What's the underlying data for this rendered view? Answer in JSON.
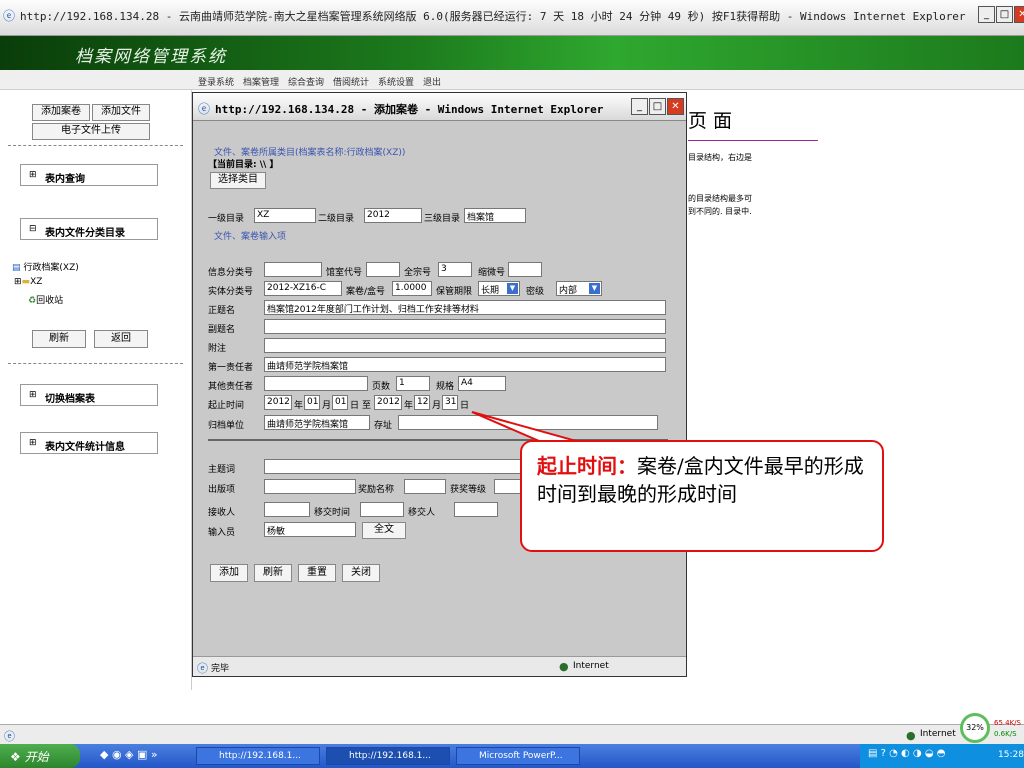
{
  "outer_window": {
    "title": "http://192.168.134.28 - 云南曲靖师范学院-南大之星档案管理系统网络版 6.0(服务器已经运行: 7 天 18 小时 24 分钟 49 秒) 按F1获得帮助 - Windows Internet Explorer"
  },
  "app": {
    "banner_title": "档案网络管理系统",
    "menu": [
      "登录系统",
      "档案管理",
      "综合查询",
      "借阅统计",
      "系统设置",
      "退出"
    ]
  },
  "sidebar": {
    "add_volume": "添加案卷",
    "add_file": "添加文件",
    "e_file_upload": "电子文件上传",
    "table_query": "表内查询",
    "table_dir": "表内文件分类目录",
    "tree_root": "行政档案(XZ)",
    "tree_child": "XZ",
    "tree_recycle": "回收站",
    "refresh": "刷新",
    "back": "返回",
    "switch_table": "切换档案表",
    "stats": "表内文件统计信息"
  },
  "background_page": {
    "heading": "页 面",
    "line1": "目录结构，右边是",
    "line2": "的目录结构最多可",
    "line3": "到不同的. 目录中."
  },
  "popup": {
    "title": "http://192.168.134.28 - 添加案卷 - Windows Internet Explorer",
    "category_line": "文件、案卷所属类目(档案表名称:行政档案(XZ))",
    "current_dir": "【当前目录: \\\\ 】",
    "select_category": "选择类目",
    "level1_label": "一级目录",
    "level1_value": "XZ",
    "level2_label": "二级目录",
    "level2_value": "2012",
    "level3_label": "三级目录",
    "level3_value": "档案馆",
    "input_section": "文件、案卷输入项",
    "info_class_label": "信息分类号",
    "archive_code_label": "馆室代号",
    "fonds_label": "全宗号",
    "fonds_value": "3",
    "microfilm_label": "缩微号",
    "entity_class_label": "实体分类号",
    "entity_class_value": "2012-XZ16-C",
    "box_label": "案卷/盒号",
    "box_value": "1.0000",
    "retention_label": "保管期限",
    "retention_value": "长期",
    "secret_label": "密级",
    "secret_value": "内部",
    "title_label": "正题名",
    "title_value": "档案馆2012年度部门工作计划、归档工作安排等材料",
    "subtitle_label": "副题名",
    "note_label": "附注",
    "first_resp_label": "第一责任者",
    "first_resp_value": "曲靖师范学院档案馆",
    "other_resp_label": "其他责任者",
    "pages_label": "页数",
    "pages_value": "1",
    "spec_label": "规格",
    "spec_value": "A4",
    "date_label": "起止时间",
    "start_year": "2012",
    "start_month": "01",
    "start_day": "01",
    "end_year": "2012",
    "end_month": "12",
    "end_day": "31",
    "year_char": "年",
    "month_char": "月",
    "day_char": "日",
    "to_char": "至",
    "archive_unit_label": "归档单位",
    "archive_unit_value": "曲靖师范学院档案馆",
    "location_label": "存址",
    "keyword_label": "主题词",
    "publish_label": "出版项",
    "award_name_label": "奖励名称",
    "award_level_label": "获奖等级",
    "receiver_label": "接收人",
    "transfer_time_label": "移交时间",
    "transferer_label": "移交人",
    "inputter_label": "输入员",
    "inputter_value": "杨敏",
    "fulltext_button": "全文",
    "add_button": "添加",
    "refresh_button": "刷新",
    "reset_button": "重置",
    "close_button": "关闭",
    "status_done": "完毕",
    "status_zone": "Internet"
  },
  "callout": {
    "label": "起止时间：",
    "text": "案卷/盒内文件最早的形成时间到最晚的形成时间"
  },
  "status_bar": {
    "zone": "Internet",
    "zoom": "32%",
    "up_speed": "65.4K/S",
    "down_speed": "0.6K/S"
  },
  "taskbar": {
    "start": "开始",
    "tasks": [
      "http://192.168.1...",
      "http://192.168.1...",
      "Microsoft PowerP..."
    ],
    "clock": "15:28"
  }
}
